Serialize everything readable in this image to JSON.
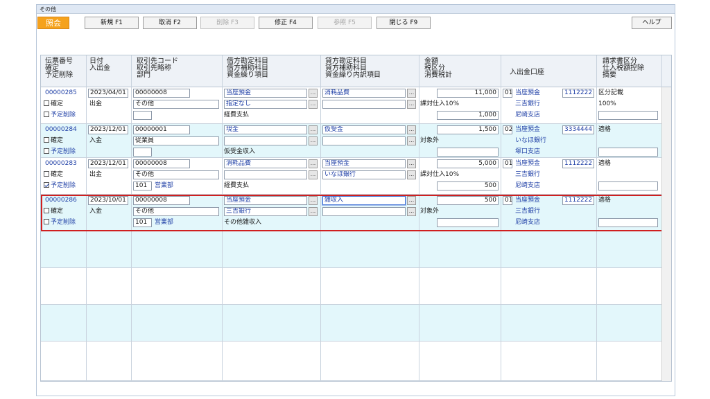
{
  "window": {
    "title": "その他"
  },
  "toolbar": {
    "mode": "照会",
    "new": "新規 F1",
    "cancel": "取消 F2",
    "delete": "削除 F3",
    "edit": "修正 F4",
    "refer": "参照 F5",
    "close": "閉じる F9",
    "help": "ヘルプ"
  },
  "headers": {
    "c1": "伝票番号\n確定\n予定削除",
    "c2": "日付\n入出金",
    "c3": "取引先コード\n取引先略称\n部門",
    "c4": "借方勘定科目\n借方補助科目\n資金繰り項目",
    "c5": "貸方勘定科目\n貸方補助科目\n資金繰り内訳項目",
    "c6": "金額\n税区分\n消費税計",
    "c7": "入出金口座",
    "c8": "請求書区分\n仕入税額控除\n摘要"
  },
  "records": [
    {
      "no": "00000285",
      "date": "2023/04/01",
      "kakutei": "確定",
      "inout": "出金",
      "yotei": "予定削除",
      "yotei_checked": false,
      "code": "00000008",
      "name": "その他",
      "dept_code": "",
      "dept_name": "",
      "debit": "当座預金",
      "debit_sub": "指定なし",
      "fund": "経費支払",
      "credit": "消耗品費",
      "credit_sub": "",
      "amount": "11,000",
      "tax": "課対仕入10%",
      "tax_amt": "1,000",
      "acct_no": "01",
      "acct_type": "当座預金",
      "acct_num": "1112222",
      "bank": "三吉銀行",
      "branch": "尼崎支店",
      "invoice": "区分記載",
      "deduct": "100%",
      "memo": ""
    },
    {
      "no": "00000284",
      "date": "2023/12/01",
      "kakutei": "確定",
      "inout": "入金",
      "yotei": "予定削除",
      "yotei_checked": false,
      "code": "00000001",
      "name": "従業員",
      "dept_code": "",
      "dept_name": "",
      "debit": "現金",
      "debit_sub": "",
      "fund": "仮受金収入",
      "credit": "仮受金",
      "credit_sub": "",
      "amount": "1,500",
      "tax": "対象外",
      "tax_amt": "",
      "acct_no": "02",
      "acct_type": "当座預金",
      "acct_num": "3334444",
      "bank": "いなほ銀行",
      "branch": "塚口支店",
      "invoice": "適格",
      "deduct": "",
      "memo": ""
    },
    {
      "no": "00000283",
      "date": "2023/12/01",
      "kakutei": "確定",
      "inout": "出金",
      "yotei": "予定削除",
      "yotei_checked": true,
      "code": "00000008",
      "name": "その他",
      "dept_code": "101",
      "dept_name": "営業部",
      "debit": "消耗品費",
      "debit_sub": "",
      "fund": "経費支払",
      "credit": "当座預金",
      "credit_sub": "いなほ銀行",
      "amount": "5,000",
      "tax": "課対仕入10%",
      "tax_amt": "500",
      "acct_no": "01",
      "acct_type": "当座預金",
      "acct_num": "1112222",
      "bank": "三吉銀行",
      "branch": "尼崎支店",
      "invoice": "適格",
      "deduct": "",
      "memo": ""
    },
    {
      "no": "00000286",
      "date": "2023/10/01",
      "kakutei": "確定",
      "inout": "入金",
      "yotei": "予定削除",
      "yotei_checked": false,
      "code": "00000008",
      "name": "その他",
      "dept_code": "101",
      "dept_name": "営業部",
      "debit": "当座預金",
      "debit_sub": "三吉銀行",
      "fund": "その他雑収入",
      "credit": "雑収入",
      "credit_sub": "",
      "amount": "500",
      "tax": "対象外",
      "tax_amt": "",
      "acct_no": "01",
      "acct_type": "当座預金",
      "acct_num": "1112222",
      "bank": "三吉銀行",
      "branch": "尼崎支店",
      "invoice": "適格",
      "deduct": "",
      "memo": ""
    }
  ],
  "colors": {
    "accent": "#f5a21c",
    "row_alt": "#e3f7fb",
    "selection": "#d01f1f",
    "link": "#1f3fa6"
  }
}
